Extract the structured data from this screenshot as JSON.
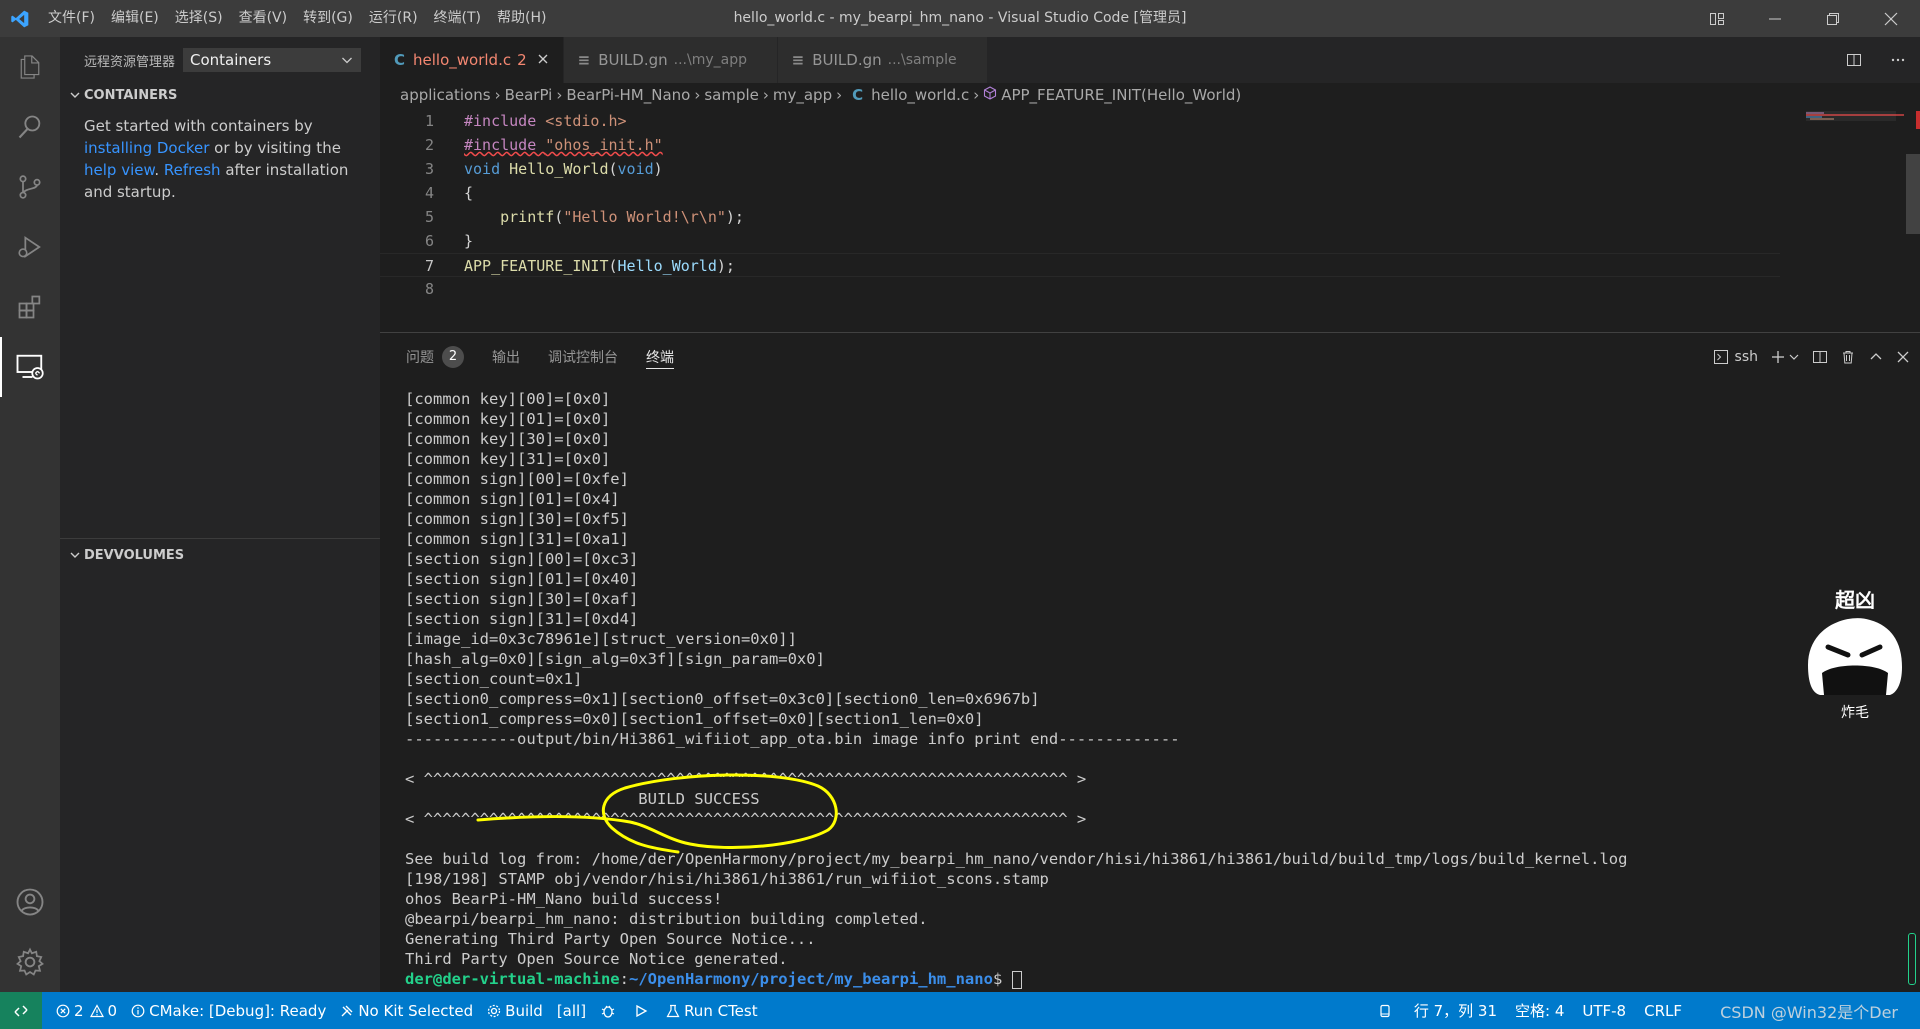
{
  "titlebar": {
    "menu": [
      "文件(F)",
      "编辑(E)",
      "选择(S)",
      "查看(V)",
      "转到(G)",
      "运行(R)",
      "终端(T)",
      "帮助(H)"
    ],
    "title": "hello_world.c - my_bearpi_hm_nano - Visual Studio Code [管理员]"
  },
  "activitybar": {
    "icons": [
      "explorer-icon",
      "search-icon",
      "source-control-icon",
      "run-debug-icon",
      "extensions-icon",
      "remote-explorer-icon"
    ],
    "bottom_icons": [
      "accounts-icon",
      "manage-gear-icon"
    ]
  },
  "sidebar": {
    "title": "远程资源管理器",
    "selector": "Containers",
    "containers_section": "CONTAINERS",
    "welcome": {
      "t1": "Get started with containers by",
      "link1": "installing Docker",
      "t2": " or by visiting the",
      "link2": "help view",
      "t3": ". ",
      "link3": "Refresh",
      "t4": " after installation",
      "t5": "and startup."
    },
    "devvolumes_section": "DEVVOLUMES"
  },
  "tabs": [
    {
      "icon": "C",
      "label": "hello_world.c",
      "num": "2"
    },
    {
      "icon": "≡",
      "label": "BUILD.gn",
      "desc": "...\\my_app"
    },
    {
      "icon": "≡",
      "label": "BUILD.gn",
      "desc": "...\\sample"
    }
  ],
  "breadcrumbs": [
    "applications",
    "BearPi",
    "BearPi-HM_Nano",
    "sample",
    "my_app",
    "hello_world.c",
    "APP_FEATURE_INIT(Hello_World)"
  ],
  "breadcrumb_file_icon": "C",
  "code": {
    "line_numbers": [
      "1",
      "2",
      "3",
      "4",
      "5",
      "6",
      "7",
      "8"
    ],
    "l1_a": "#include ",
    "l1_b": "<stdio.h>",
    "l2_a": "#include ",
    "l2_b": "\"ohos_init.h\"",
    "l3_a": "void ",
    "l3_b": "Hello_World",
    "l3_c": "(",
    "l3_d": "void",
    "l3_e": ")",
    "l4": "{",
    "l5_a": "    ",
    "l5_b": "printf",
    "l5_c": "(",
    "l5_d": "\"Hello World!\\r\\n\"",
    "l5_e": ");",
    "l6": "}",
    "l7_a": "APP_FEATURE_INIT",
    "l7_b": "(",
    "l7_c": "Hello_World",
    "l7_d": ");"
  },
  "panel": {
    "tabs": [
      "问题",
      "输出",
      "调试控制台",
      "终端"
    ],
    "problems_count": "2",
    "terminal_name": "ssh"
  },
  "terminal": {
    "lines": [
      "[common key][00]=[0x0]",
      "[common key][01]=[0x0]",
      "[common key][30]=[0x0]",
      "[common key][31]=[0x0]",
      "[common sign][00]=[0xfe]",
      "[common sign][01]=[0x4]",
      "[common sign][30]=[0xf5]",
      "[common sign][31]=[0xa1]",
      "[section sign][00]=[0xc3]",
      "[section sign][01]=[0x40]",
      "[section sign][30]=[0xaf]",
      "[section sign][31]=[0xd4]",
      "[image_id=0x3c78961e][struct_version=0x0]]",
      "[hash_alg=0x0][sign_alg=0x3f][sign_param=0x0]",
      "[section_count=0x1]",
      "[section0_compress=0x1][section0_offset=0x3c0][section0_len=0x6967b]",
      "[section1_compress=0x0][section1_offset=0x0][section1_len=0x0]",
      "------------output/bin/Hi3861_wifiiot_app_ota.bin image info print end-------------",
      "",
      "< ^^^^^^^^^^^^^^^^^^^^^^^^^^^^^^^^^^^^^^^^^^^^^^^^^^^^^^^^^^^^^^^^^^^^^ >",
      "                         BUILD SUCCESS",
      "< ^^^^^^^^^^^^^^^^^^^^^^^^^^^^^^^^^^^^^^^^^^^^^^^^^^^^^^^^^^^^^^^^^^^^^ >",
      "",
      "See build log from: /home/der/OpenHarmony/project/my_bearpi_hm_nano/vendor/hisi/hi3861/hi3861/build/build_tmp/logs/build_kernel.log",
      "[198/198] STAMP obj/vendor/hisi/hi3861/hi3861/run_wifiiot_scons.stamp",
      "ohos BearPi-HM_Nano build success!",
      "@bearpi/bearpi_hm_nano: distribution building completed.",
      "Generating Third Party Open Source Notice...",
      "Third Party Open Source Notice generated."
    ],
    "prompt_user": "der@der-virtual-machine",
    "prompt_sep": ":",
    "prompt_path": "~/OpenHarmony/project/my_bearpi_hm_nano",
    "prompt_end": "$ "
  },
  "statusbar": {
    "errors": "2",
    "warnings": "0",
    "cmake": "CMake: [Debug]: Ready",
    "kit": "No Kit Selected",
    "build": "Build",
    "target": "[all]",
    "ctest": "Run CTest",
    "position": "行 7，列 31",
    "spaces": "空格: 4",
    "encoding": "UTF-8",
    "eol": "CRLF",
    "watermark": "CSDN @Win32是个Der"
  },
  "colors": {
    "accent": "#007acc",
    "remote_indicator": "#16825d",
    "annotation": "#ffff00"
  }
}
